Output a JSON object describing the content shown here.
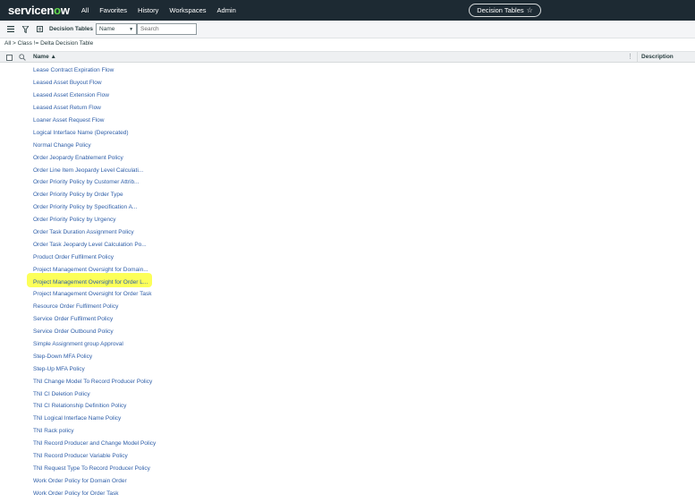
{
  "topnav": {
    "logo_part1": "servicen",
    "logo_o": "o",
    "logo_part2": "w",
    "menu": [
      "All",
      "Favorites",
      "History",
      "Workspaces",
      "Admin"
    ],
    "context_title": "Decision Tables",
    "star_glyph": "☆"
  },
  "toolbar": {
    "title": "Decision Tables",
    "field_select_value": "Name",
    "search_placeholder": "Search"
  },
  "breadcrumb": {
    "text": "All > Class != Delta Decision Table"
  },
  "table": {
    "columns": [
      "Name ▲",
      "Description"
    ],
    "rows": [
      "Lease Contract Expiration Flow",
      "Leased Asset Buyout Flow",
      "Leased Asset Extension Flow",
      "Leased Asset Return Flow",
      "Loaner Asset Request Flow",
      "Logical Interface Name (Deprecated)",
      "Normal Change Policy",
      "Order Jeopardy Enablement Policy",
      "Order Line Item Jeopardy Level Calculati...",
      "Order Priority Policy by Customer Attrib...",
      "Order Priority Policy by Order Type",
      "Order Priority Policy by Specification A...",
      "Order Priority Policy by Urgency",
      "Order Task Duration Assignment Policy",
      "Order Task Jeopardy Level Calculation Po...",
      "Product Order Fulfilment Policy",
      "Project Management Oversight for Domain...",
      "Project Management Oversight for Order L...",
      "Project Management Oversight for Order Task",
      "Resource Order Fulfilment Policy",
      "Service Order Fulfilment Policy",
      "Service Order Outbound Policy",
      "Simple Assignment group Approval",
      "Step-Down MFA Policy",
      "Step-Up MFA Policy",
      "TNI Change Model To Record Producer Policy",
      "TNI CI Deletion Policy",
      "TNI CI Relationship Definition Policy",
      "TNI Logical Interface Name Policy",
      "TNI Rack policy",
      "TNI Record Producer and Change Model Policy",
      "TNI Record Producer Variable Policy",
      "TNI Request Type To Record Producer Policy",
      "Work Order Policy for Domain Order",
      "Work Order Policy for Order Task"
    ],
    "highlighted_row_index": 17
  },
  "colors": {
    "nav_bg": "#1d2a33",
    "logo_accent": "#62d84e",
    "link": "#2e5ea8",
    "highlight": "#fbff3c"
  }
}
